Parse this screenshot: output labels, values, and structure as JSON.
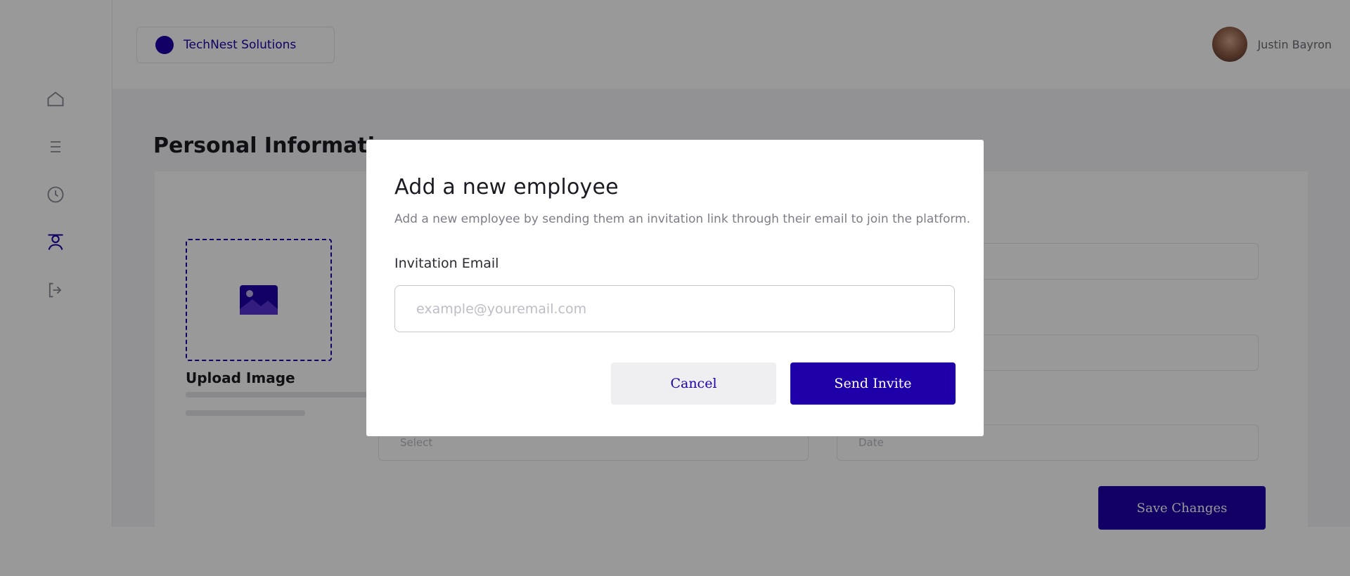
{
  "header": {
    "brand_name": "TechNest Solutions",
    "user_name": "Justin Bayron"
  },
  "sidebar": {
    "items": [
      {
        "icon": "home-icon"
      },
      {
        "icon": "list-icon"
      },
      {
        "icon": "clock-icon"
      },
      {
        "icon": "employees-icon",
        "active": true
      },
      {
        "icon": "logout-icon"
      }
    ]
  },
  "page": {
    "title": "Personal Information",
    "upload_title": "Upload Image",
    "save_label": "Save Changes",
    "ghost_field_left": "Select",
    "ghost_field_right": "Date"
  },
  "modal": {
    "title": "Add a new employee",
    "description": "Add a new employee by sending them an invitation link through their email to join the platform.",
    "email_label": "Invitation Email",
    "email_placeholder": "example@youremail.com",
    "email_value": "",
    "cancel_label": "Cancel",
    "send_label": "Send Invite"
  },
  "colors": {
    "accent": "#1f00a8",
    "overlay": "rgba(0,0,0,0.40)",
    "cancel_bg": "#efeff1"
  }
}
